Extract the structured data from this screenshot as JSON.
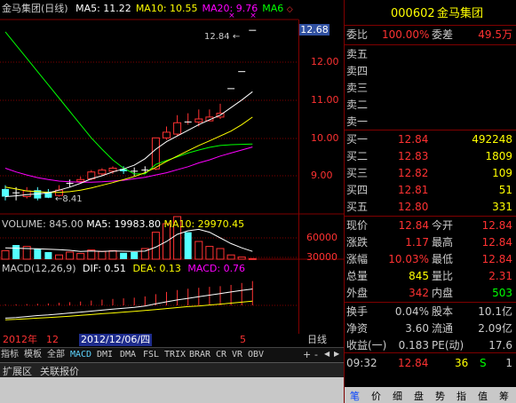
{
  "kline": {
    "title": "金马集团(日线)",
    "ma_labels": [
      {
        "text": "MA5: 11.22",
        "color": "#ffffff"
      },
      {
        "text": "MA10: 10.55",
        "color": "#ffff00"
      },
      {
        "text": "MA20: 9.76",
        "color": "#ff00ff"
      },
      {
        "text": "MA6",
        "color": "#00ff00"
      }
    ],
    "price_ticks": [
      "12.00",
      "11.00",
      "10.00",
      "9.00"
    ],
    "current_price_tag": "12.68",
    "high_marker": "12.84",
    "low_marker": "8.41",
    "candles": [
      {
        "o": 8.65,
        "c": 8.45,
        "h": 8.75,
        "l": 8.35
      },
      {
        "o": 8.55,
        "c": 8.55,
        "h": 8.7,
        "l": 8.35
      },
      {
        "o": 8.45,
        "c": 8.6,
        "h": 8.7,
        "l": 8.4
      },
      {
        "o": 8.62,
        "c": 8.4,
        "h": 8.7,
        "l": 8.35
      },
      {
        "o": 8.58,
        "c": 8.42,
        "h": 8.65,
        "l": 8.41
      },
      {
        "o": 8.48,
        "c": 8.62,
        "h": 8.75,
        "l": 8.45
      },
      {
        "o": 8.8,
        "c": 8.8,
        "h": 8.9,
        "l": 8.7
      },
      {
        "o": 8.85,
        "c": 8.9,
        "h": 8.98,
        "l": 8.8
      },
      {
        "o": 8.92,
        "c": 9.1,
        "h": 9.15,
        "l": 8.88
      },
      {
        "o": 9.05,
        "c": 9.15,
        "h": 9.2,
        "l": 9.0
      },
      {
        "o": 9.12,
        "c": 9.2,
        "h": 9.25,
        "l": 9.05
      },
      {
        "o": 9.18,
        "c": 9.12,
        "h": 9.25,
        "l": 9.05
      },
      {
        "o": 9.12,
        "c": 9.12,
        "h": 9.22,
        "l": 9.0
      },
      {
        "o": 9.15,
        "c": 9.15,
        "h": 9.25,
        "l": 9.05
      },
      {
        "o": 9.18,
        "c": 10.0,
        "h": 10.0,
        "l": 9.15
      },
      {
        "o": 10.0,
        "c": 10.15,
        "h": 10.3,
        "l": 9.95
      },
      {
        "o": 10.1,
        "c": 10.4,
        "h": 10.6,
        "l": 10.05
      },
      {
        "o": 10.4,
        "c": 10.42,
        "h": 10.65,
        "l": 10.35
      },
      {
        "o": 10.42,
        "c": 10.5,
        "h": 10.75,
        "l": 10.3
      },
      {
        "o": 10.45,
        "c": 10.55,
        "h": 10.75,
        "l": 10.45
      },
      {
        "o": 10.55,
        "c": 10.65,
        "h": 10.9,
        "l": 10.5
      },
      {
        "o": 11.3,
        "c": 11.3,
        "h": 11.3,
        "l": 11.3
      },
      {
        "o": 11.75,
        "c": 11.75,
        "h": 11.75,
        "l": 11.75
      },
      {
        "o": 12.84,
        "c": 12.84,
        "h": 12.84,
        "l": 12.84
      }
    ],
    "ma5": [
      8.45,
      8.47,
      8.5,
      8.52,
      8.55,
      8.62,
      8.7,
      8.8,
      8.92,
      9.0,
      9.1,
      9.18,
      9.28,
      9.45,
      9.7,
      9.9,
      10.05,
      10.2,
      10.35,
      10.48,
      10.6,
      10.8,
      11.0,
      11.22
    ],
    "ma10": [
      8.7,
      8.65,
      8.6,
      8.58,
      8.56,
      8.56,
      8.58,
      8.62,
      8.68,
      8.75,
      8.82,
      8.9,
      8.98,
      9.08,
      9.22,
      9.38,
      9.52,
      9.66,
      9.8,
      9.92,
      10.05,
      10.18,
      10.35,
      10.55
    ],
    "ma20": [
      9.2,
      9.1,
      9.02,
      8.95,
      8.9,
      8.86,
      8.84,
      8.83,
      8.83,
      8.84,
      8.86,
      8.88,
      8.92,
      8.96,
      9.02,
      9.08,
      9.16,
      9.24,
      9.34,
      9.42,
      9.52,
      9.6,
      9.68,
      9.76
    ],
    "ma6": [
      12.8,
      12.45,
      12.1,
      11.75,
      11.4,
      11.05,
      10.7,
      10.35,
      10.0,
      9.7,
      9.42,
      9.2,
      9.05,
      9.05,
      9.3,
      9.4,
      9.5,
      9.6,
      9.68,
      9.75,
      9.8,
      9.82,
      9.83,
      9.84
    ]
  },
  "volume": {
    "title": "VOLUME: 845.00",
    "ma5_label": "MA5: 19983.80",
    "ma10_label": "MA10: 29970.45",
    "ticks": [
      "60000",
      "30000"
    ],
    "bars": [
      12000,
      20000,
      18000,
      15000,
      10000,
      6000,
      10000,
      8000,
      13000,
      11000,
      12000,
      9000,
      10000,
      15000,
      38000,
      50000,
      60000,
      38000,
      25000,
      18000,
      15000,
      6000,
      3000,
      845
    ],
    "up": [
      true,
      false,
      true,
      false,
      false,
      true,
      true,
      true,
      true,
      true,
      true,
      false,
      false,
      true,
      true,
      true,
      true,
      false,
      true,
      true,
      true,
      true,
      true,
      true
    ],
    "ma5": [
      16000,
      15500,
      15000,
      14800,
      14000,
      13500,
      12500,
      11000,
      11500,
      11000,
      11500,
      11200,
      11000,
      11400,
      17000,
      25000,
      35000,
      40000,
      42000,
      38000,
      30000,
      22000,
      16000,
      11000
    ]
  },
  "macd": {
    "title": "MACD(12,26,9)",
    "dif_label": "DIF: 0.51",
    "dea_label": "DEA: 0.13",
    "macd_label": "MACD: 0.76",
    "hist": [
      0.02,
      0.03,
      0.04,
      0.05,
      0.06,
      0.08,
      0.1,
      0.12,
      0.15,
      0.18,
      0.2,
      0.22,
      0.24,
      0.28,
      0.35,
      0.42,
      0.48,
      0.52,
      0.55,
      0.58,
      0.6,
      0.64,
      0.7,
      0.76
    ],
    "dif": [
      -0.4,
      -0.38,
      -0.35,
      -0.32,
      -0.3,
      -0.27,
      -0.24,
      -0.21,
      -0.18,
      -0.15,
      -0.12,
      -0.09,
      -0.06,
      -0.02,
      0.05,
      0.11,
      0.17,
      0.22,
      0.27,
      0.32,
      0.37,
      0.42,
      0.47,
      0.51
    ],
    "dea": [
      -0.45,
      -0.44,
      -0.42,
      -0.4,
      -0.38,
      -0.36,
      -0.34,
      -0.31,
      -0.29,
      -0.26,
      -0.24,
      -0.21,
      -0.19,
      -0.16,
      -0.13,
      -0.1,
      -0.07,
      -0.04,
      -0.02,
      0.01,
      0.04,
      0.07,
      0.1,
      0.13
    ]
  },
  "timeline": {
    "year_label": "2012年",
    "month_label": "12",
    "date_cursor": "2012/12/06/四",
    "tick_5": "5",
    "period": "日线"
  },
  "indicator_tabs": [
    "指标",
    "模板",
    "全部",
    "MACD",
    "DMI",
    "DMA",
    "FSL",
    "TRIX",
    "BRAR",
    "CR",
    "VR",
    "OBV"
  ],
  "extra_tabs": [
    "扩展区",
    "关联报价"
  ],
  "quote": {
    "code": "000602",
    "name": "金马集团",
    "weibi_label": "委比",
    "weibi_value": "100.00%",
    "weicha_label": "委差",
    "weicha_value": "49.5万",
    "asks": [
      {
        "label": "卖五",
        "price": "",
        "vol": ""
      },
      {
        "label": "卖四",
        "price": "",
        "vol": ""
      },
      {
        "label": "卖三",
        "price": "",
        "vol": ""
      },
      {
        "label": "卖二",
        "price": "",
        "vol": ""
      },
      {
        "label": "卖一",
        "price": "",
        "vol": ""
      }
    ],
    "bids": [
      {
        "label": "买一",
        "price": "12.84",
        "vol": "492248"
      },
      {
        "label": "买二",
        "price": "12.83",
        "vol": "1809"
      },
      {
        "label": "买三",
        "price": "12.82",
        "vol": "109"
      },
      {
        "label": "买四",
        "price": "12.81",
        "vol": "51"
      },
      {
        "label": "买五",
        "price": "12.80",
        "vol": "331"
      }
    ],
    "stats": [
      {
        "l1": "现价",
        "v1": "12.84",
        "c1": "#ff3232",
        "l2": "今开",
        "v2": "12.84",
        "c2": "#ff3232"
      },
      {
        "l1": "涨跌",
        "v1": "1.17",
        "c1": "#ff3232",
        "l2": "最高",
        "v2": "12.84",
        "c2": "#ff3232"
      },
      {
        "l1": "涨幅",
        "v1": "10.03%",
        "c1": "#ff3232",
        "l2": "最低",
        "v2": "12.84",
        "c2": "#ff3232"
      },
      {
        "l1": "总量",
        "v1": "845",
        "c1": "#ffff00",
        "l2": "量比",
        "v2": "2.31",
        "c2": "#ff3232"
      },
      {
        "l1": "外盘",
        "v1": "342",
        "c1": "#ff3232",
        "l2": "内盘",
        "v2": "503",
        "c2": "#00ff00"
      }
    ],
    "finance": [
      {
        "l1": "换手",
        "v1": "0.04%",
        "l2": "股本",
        "v2": "10.1亿"
      },
      {
        "l1": "净资",
        "v1": "3.60",
        "l2": "流通",
        "v2": "2.09亿"
      },
      {
        "l1": "收益(一)",
        "v1": "0.183",
        "l2": "PE(动)",
        "v2": "17.6"
      }
    ],
    "tick": {
      "time": "09:32",
      "price": "12.84",
      "vol": "36",
      "side": "S",
      "num": "1"
    },
    "bottom_tabs": [
      "笔",
      "价",
      "细",
      "盘",
      "势",
      "指",
      "值",
      "筹"
    ]
  }
}
